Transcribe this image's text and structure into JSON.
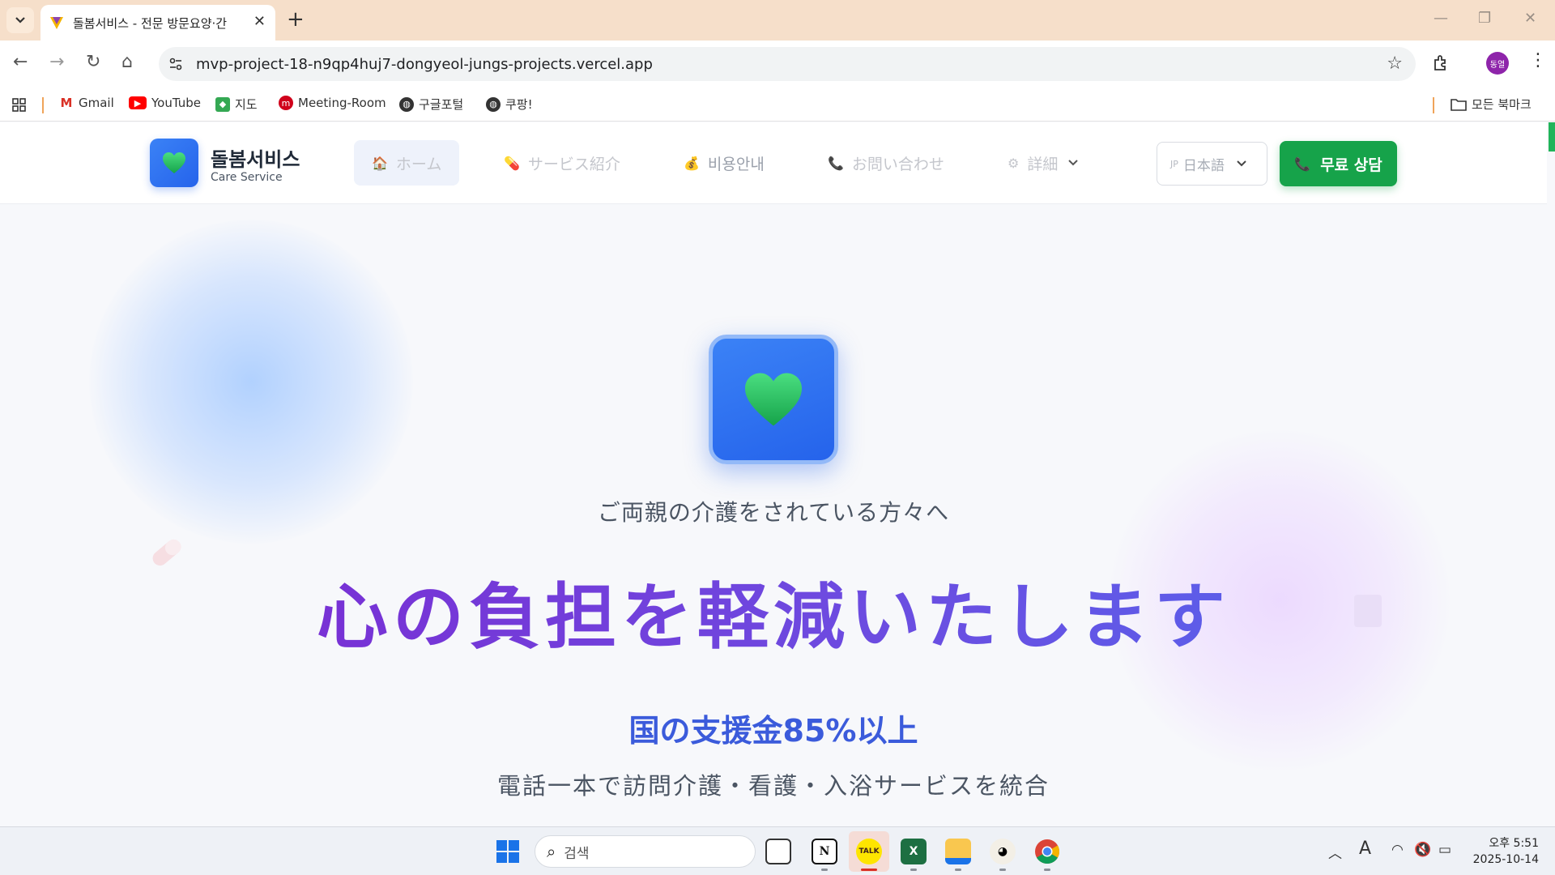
{
  "browser": {
    "tab_title": "돌봄서비스 - 전문 방문요양·간",
    "url": "mvp-project-18-n9qp4huj7-dongyeol-jungs-projects.vercel.app",
    "profile_initials": "동열",
    "bookmarks": [
      {
        "label": "Gmail",
        "icon": "gmail-icon"
      },
      {
        "label": "YouTube",
        "icon": "youtube-icon"
      },
      {
        "label": "지도",
        "icon": "maps-icon"
      },
      {
        "label": "Meeting-Room",
        "icon": "meeting-room-icon"
      },
      {
        "label": "구글포털",
        "icon": "globe-icon"
      },
      {
        "label": "쿠팡!",
        "icon": "globe-icon"
      }
    ],
    "all_bookmarks_label": "모든 북마크"
  },
  "header": {
    "brand_name": "돌봄서비스",
    "brand_sub": "Care Service",
    "nav": [
      {
        "label": "ホーム",
        "icon": "house-icon"
      },
      {
        "label": "サービス紹介",
        "icon": "pill-icon"
      },
      {
        "label": "비용안내",
        "icon": "money-bag-icon"
      },
      {
        "label": "お問い合わせ",
        "icon": "phone-icon"
      },
      {
        "label": "詳細",
        "icon": "gear-icon"
      }
    ],
    "language_code": "JP",
    "language_label": "日本語",
    "cta_label": "무료 상담"
  },
  "hero": {
    "subtitle": "ご両親の介護をされている方々へ",
    "title": "心の負担を軽減いたします",
    "support": "国の支援金85%以上",
    "description": "電話一本で訪問介護・看護・入浴サービスを統合"
  },
  "taskbar": {
    "search_placeholder": "검색",
    "time": "오후 5:51",
    "date": "2025-10-14"
  },
  "colors": {
    "primary_blue": "#2563eb",
    "cta_green": "#16a34a",
    "title_purple": "#7e22ce",
    "support_blue": "#3b5bdb"
  }
}
